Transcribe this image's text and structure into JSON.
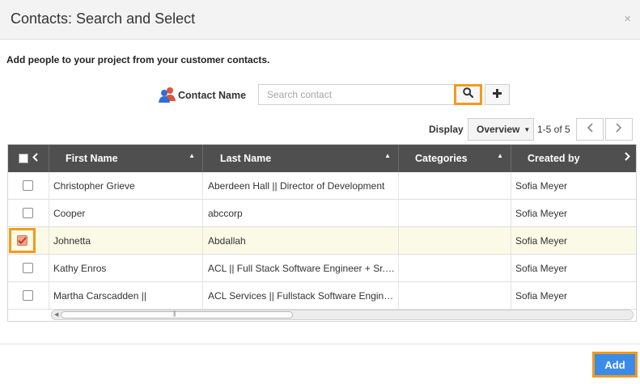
{
  "dialog": {
    "title": "Contacts: Search and Select",
    "close_glyph": "×"
  },
  "intro_text": "Add people to your project from your customer contacts.",
  "search": {
    "label": "Contact Name",
    "placeholder": "Search contact",
    "value": "",
    "search_icon": "search-icon",
    "add_icon": "plus-icon"
  },
  "toolbar": {
    "display_label": "Display",
    "view_selected": "Overview",
    "pager_text": "1-5 of 5"
  },
  "table": {
    "columns": [
      "First Name",
      "Last Name",
      "Categories",
      "Created by"
    ],
    "rows": [
      {
        "first": "Christopher Grieve",
        "last": "Aberdeen Hall || Director of Development",
        "category": "",
        "created_by": "Sofia Meyer",
        "checked": false
      },
      {
        "first": "Cooper",
        "last": "abccorp",
        "category": "",
        "created_by": "Sofia Meyer",
        "checked": false
      },
      {
        "first": "Johnetta",
        "last": "Abdallah",
        "category": "",
        "created_by": "Sofia Meyer",
        "checked": true
      },
      {
        "first": "Kathy Enros",
        "last": "ACL || Full Stack Software Engineer + Sr.…",
        "category": "",
        "created_by": "Sofia Meyer",
        "checked": false
      },
      {
        "first": "Martha Carscadden ||",
        "last": "ACL Services || Fullstack Software Engin…",
        "category": "",
        "created_by": "Sofia Meyer",
        "checked": false
      }
    ]
  },
  "footer": {
    "add_label": "Add"
  },
  "colors": {
    "highlight": "#f29b1f",
    "primary_button": "#3b8ce8",
    "header_bg": "#4f4f4f",
    "selected_row_bg": "#fafae6"
  }
}
